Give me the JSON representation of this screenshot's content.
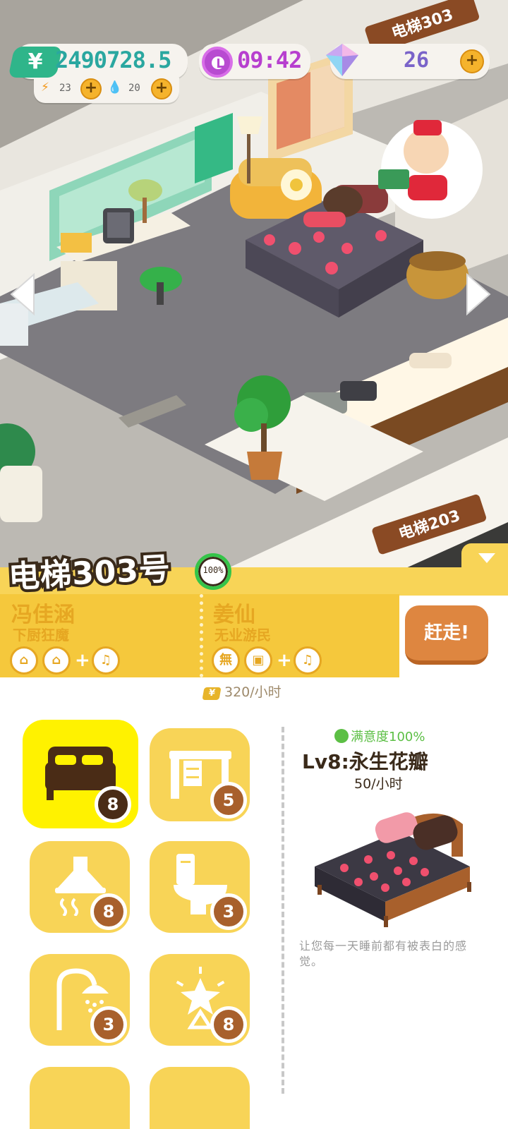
{
  "hud": {
    "money": "2490728.5",
    "money_symbol": "¥",
    "energy": "23",
    "water": "20",
    "time": "09:42",
    "gems": "26",
    "plus": "+"
  },
  "scene": {
    "elevator_sign_top": "电梯303",
    "elevator_sign_bottom": "电梯203"
  },
  "room": {
    "title": "电梯303号",
    "occupancy": "100%",
    "tenants": [
      {
        "name": "冯佳涵",
        "job": "下厨狂魔",
        "icons": [
          "basket-icon",
          "basket-icon",
          "music-icon"
        ]
      },
      {
        "name": "姜仙",
        "job": "无业游民",
        "icons": [
          "wu-icon",
          "box-icon",
          "music-icon"
        ]
      }
    ],
    "plus": "+",
    "evict_label": "赶走!",
    "rent_rate": "320/小时",
    "rent_symbol": "¥"
  },
  "furniture": [
    {
      "name": "bed-icon",
      "count": "8",
      "selected": true
    },
    {
      "name": "desk-icon",
      "count": "5",
      "selected": false
    },
    {
      "name": "range-hood-icon",
      "count": "8",
      "selected": false
    },
    {
      "name": "toilet-icon",
      "count": "3",
      "selected": false
    },
    {
      "name": "shower-icon",
      "count": "3",
      "selected": false
    },
    {
      "name": "lamp-icon",
      "count": "8",
      "selected": false
    }
  ],
  "detail": {
    "satisfaction": "满意度100%",
    "item_name": "Lv8:永生花瓣",
    "item_rate": "50/小时",
    "description": "让您每一天睡前都有被表白的感觉。"
  },
  "colors": {
    "accent_yellow": "#f8d457",
    "selected_yellow": "#fff200",
    "money_green": "#2aa7a0",
    "time_purple": "#b73fcf",
    "gem_purple": "#7a63c9",
    "evict_orange": "#de8640",
    "satisfaction_green": "#5cbf45"
  }
}
